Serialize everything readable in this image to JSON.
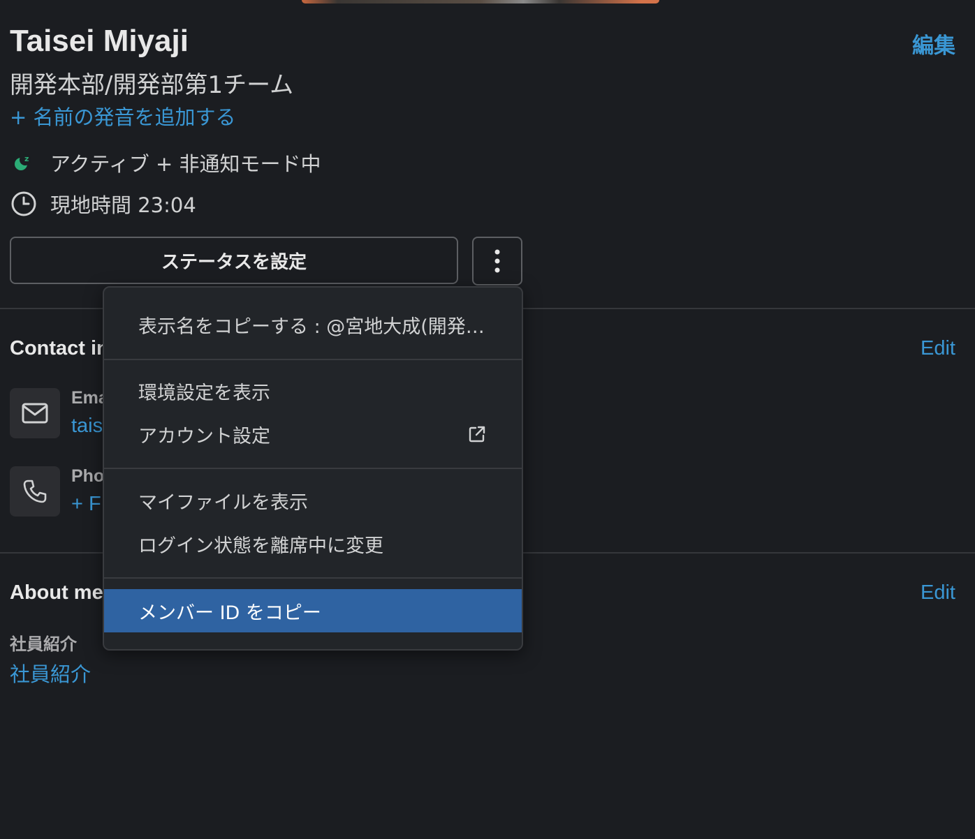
{
  "profile": {
    "name": "Taisei Miyaji",
    "edit_label": "編集",
    "team": "開発本部/開発部第1チーム",
    "add_pronunciation": "+ 名前の発音を追加する",
    "status_text": "アクティブ + 非通知モード中",
    "local_time": "現地時間 23:04",
    "set_status_button": "ステータスを設定"
  },
  "contact": {
    "title": "Contact in",
    "edit_label": "Edit",
    "email_label": "Ema",
    "email_value": "tais",
    "phone_label": "Pho",
    "phone_value": "+ F"
  },
  "about": {
    "title": "About me",
    "edit_label": "Edit",
    "field_label": "社員紹介",
    "field_value": "社員紹介"
  },
  "menu": {
    "items": [
      {
        "label": "表示名をコピーする : @宮地大成(開発…"
      },
      {
        "label": "環境設定を表示"
      },
      {
        "label": "アカウント設定"
      },
      {
        "label": "マイファイルを表示"
      },
      {
        "label": "ログイン状態を離席中に変更"
      },
      {
        "label": "メンバー ID をコピー"
      }
    ]
  },
  "colors": {
    "background": "#1b1d21",
    "link": "#3a97d4",
    "highlight": "#2f63a2",
    "active_dot": "#2bac76"
  }
}
